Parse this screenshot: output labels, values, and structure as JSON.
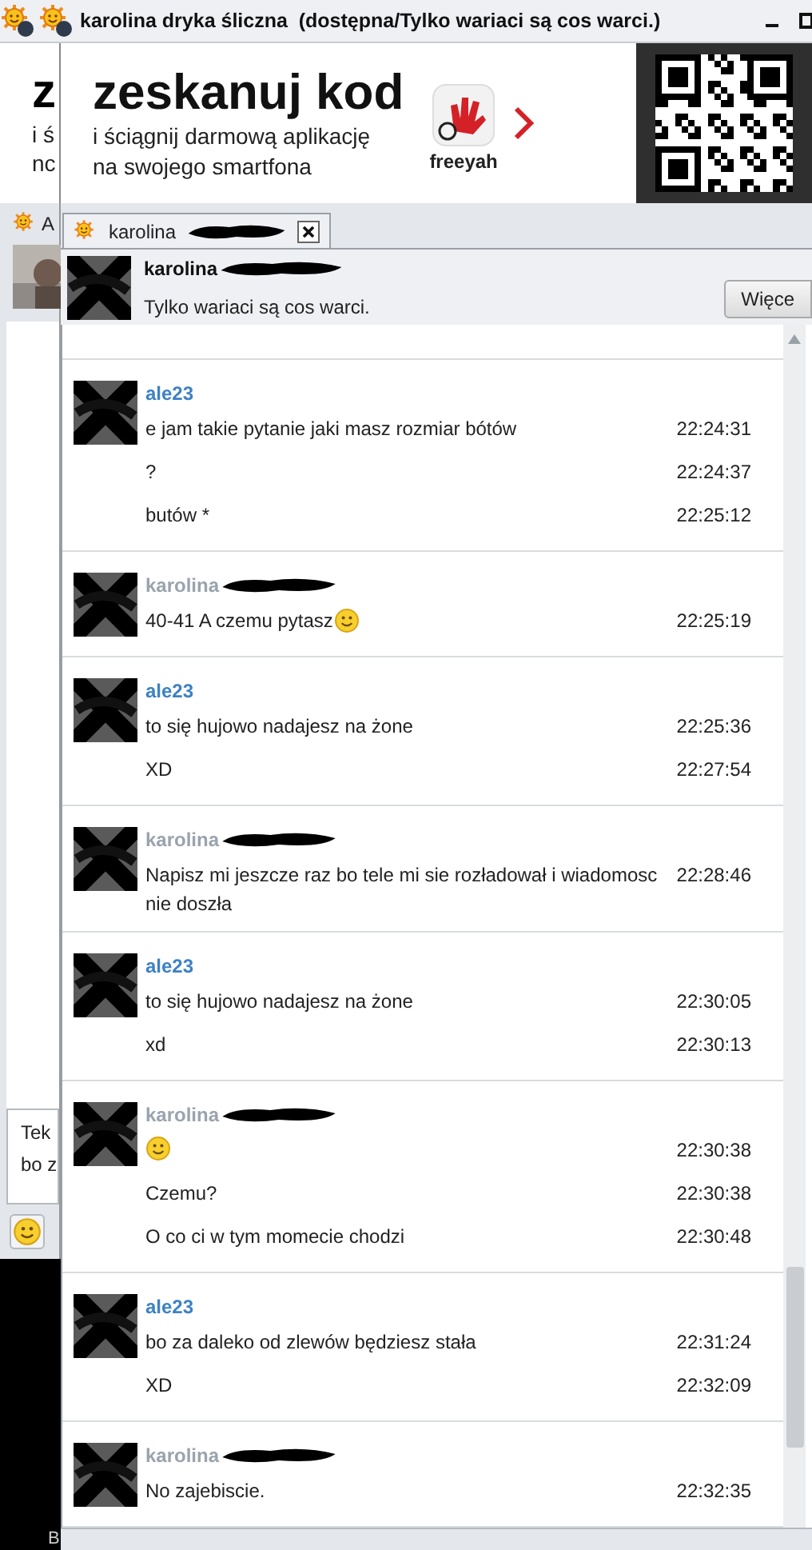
{
  "title_bar": {
    "title": "karolina dryka śliczna  (dostępna/Tylko wariaci są cos warci.)"
  },
  "background_window": {
    "ad_fragments": [
      "z",
      "i ś",
      "nc"
    ],
    "tab_label": "A",
    "input_lines": [
      "Tek",
      "bo z"
    ],
    "bottom_label": "B"
  },
  "ad": {
    "headline": "zeskanuj kod",
    "lines": [
      "i ściągnij darmową aplikację",
      "na swojego smartfona"
    ],
    "brand": "freeyah"
  },
  "tabs": [
    {
      "label": "karolina",
      "selected": true
    }
  ],
  "contact": {
    "name": "karolina",
    "status": "Tylko wariaci są cos warci.",
    "more_button": "Więce"
  },
  "messages": [
    {
      "sender": "ale23",
      "color": "#3d82c4",
      "lines": [
        {
          "text": "e jam takie pytanie jaki masz rozmiar bótów",
          "time": "22:24:31",
          "emoticon": false
        },
        {
          "text": "?",
          "time": "22:24:37",
          "emoticon": false
        },
        {
          "text": "butów *",
          "time": "22:25:12",
          "emoticon": false
        }
      ]
    },
    {
      "sender": "karolina",
      "color": "#9aa3ae",
      "lines": [
        {
          "text": "40-41 A czemu pytasz",
          "time": "22:25:19",
          "emoticon": true
        }
      ]
    },
    {
      "sender": "ale23",
      "color": "#3d82c4",
      "lines": [
        {
          "text": "to się hujowo nadajesz na żone",
          "time": "22:25:36",
          "emoticon": false
        },
        {
          "text": "XD",
          "time": "22:27:54",
          "emoticon": false
        }
      ]
    },
    {
      "sender": "karolina",
      "color": "#9aa3ae",
      "lines": [
        {
          "text": "Napisz mi jeszcze raz bo tele mi sie rozładował i wiadomosc nie doszła",
          "time": "22:28:46",
          "emoticon": false
        }
      ]
    },
    {
      "sender": "ale23",
      "color": "#3d82c4",
      "lines": [
        {
          "text": "to się hujowo nadajesz na żone",
          "time": "22:30:05",
          "emoticon": false
        },
        {
          "text": "xd",
          "time": "22:30:13",
          "emoticon": false
        }
      ]
    },
    {
      "sender": "karolina",
      "color": "#9aa3ae",
      "lines": [
        {
          "time": "22:30:38",
          "emoticon": true
        },
        {
          "text": "Czemu?",
          "time": "22:30:38",
          "emoticon": false
        },
        {
          "text": "O co ci w tym momecie chodzi",
          "time": "22:30:48",
          "emoticon": false
        }
      ]
    },
    {
      "sender": "ale23",
      "color": "#3d82c4",
      "lines": [
        {
          "text": "bo za daleko od zlewów będziesz stała",
          "time": "22:31:24",
          "emoticon": false
        },
        {
          "text": "XD",
          "time": "22:32:09",
          "emoticon": false
        }
      ]
    },
    {
      "sender": "karolina",
      "color": "#9aa3ae",
      "lines": [
        {
          "text": "No zajebiscie.",
          "time": "22:32:35",
          "emoticon": false
        }
      ]
    }
  ]
}
